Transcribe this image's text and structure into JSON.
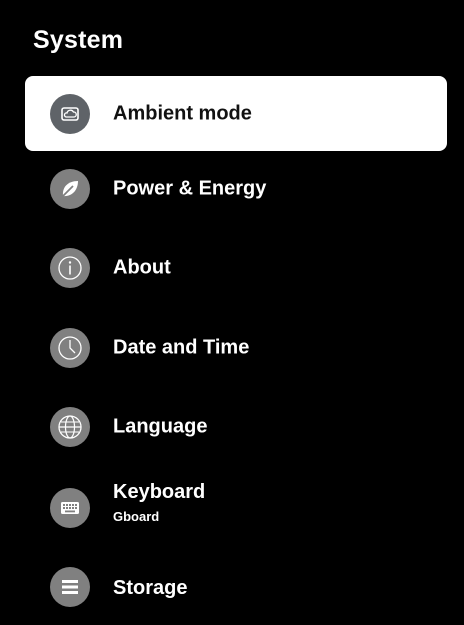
{
  "header": {
    "title": "System"
  },
  "menu": {
    "items": [
      {
        "label": "Ambient mode",
        "icon": "ambient-icon",
        "selected": true
      },
      {
        "label": "Power & Energy",
        "icon": "leaf-icon"
      },
      {
        "label": "About",
        "icon": "info-icon"
      },
      {
        "label": "Date and Time",
        "icon": "clock-icon"
      },
      {
        "label": "Language",
        "icon": "globe-icon"
      },
      {
        "label": "Keyboard",
        "sublabel": "Gboard",
        "icon": "keyboard-icon"
      },
      {
        "label": "Storage",
        "icon": "storage-icon"
      }
    ]
  },
  "colors": {
    "background": "#000000",
    "selected_bg": "#ffffff",
    "icon_circle": "#808080"
  }
}
